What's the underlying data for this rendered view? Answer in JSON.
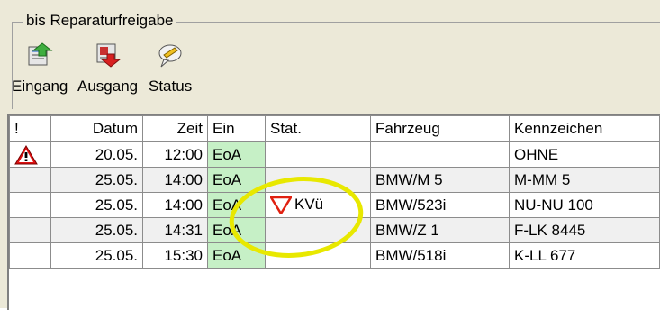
{
  "group": {
    "title": "bis Reparaturfreigabe"
  },
  "toolbar": {
    "eingang_label": "Eingang",
    "ausgang_label": "Ausgang",
    "status_label": "Status"
  },
  "table": {
    "columns": [
      "!",
      "Datum",
      "Zeit",
      "Ein",
      "Stat.",
      "Fahrzeug",
      "Kennzeichen"
    ],
    "rows": [
      {
        "flag": "warning",
        "datum": "20.05.",
        "zeit": "12:00",
        "ein": "EoA",
        "stat": "",
        "fahrzeug": "",
        "kennzeichen": "OHNE"
      },
      {
        "flag": "",
        "datum": "25.05.",
        "zeit": "14:00",
        "ein": "EoA",
        "stat": "",
        "fahrzeug": "BMW/M 5",
        "kennzeichen": "M-MM 5"
      },
      {
        "flag": "",
        "datum": "25.05.",
        "zeit": "14:00",
        "ein": "EoA",
        "stat": "KVü",
        "stat_icon": "red-down-triangle",
        "fahrzeug": "BMW/523i",
        "kennzeichen": "NU-NU 100"
      },
      {
        "flag": "",
        "datum": "25.05.",
        "zeit": "14:31",
        "ein": "EoA",
        "stat": "",
        "fahrzeug": "BMW/Z 1",
        "kennzeichen": "F-LK 8445"
      },
      {
        "flag": "",
        "datum": "25.05.",
        "zeit": "15:30",
        "ein": "EoA",
        "stat": "",
        "fahrzeug": "BMW/518i",
        "kennzeichen": "K-LL 677"
      }
    ]
  },
  "colors": {
    "ein_bg": "#c6f0c6",
    "warning": "#e01010",
    "highlight": "#e8e800"
  }
}
